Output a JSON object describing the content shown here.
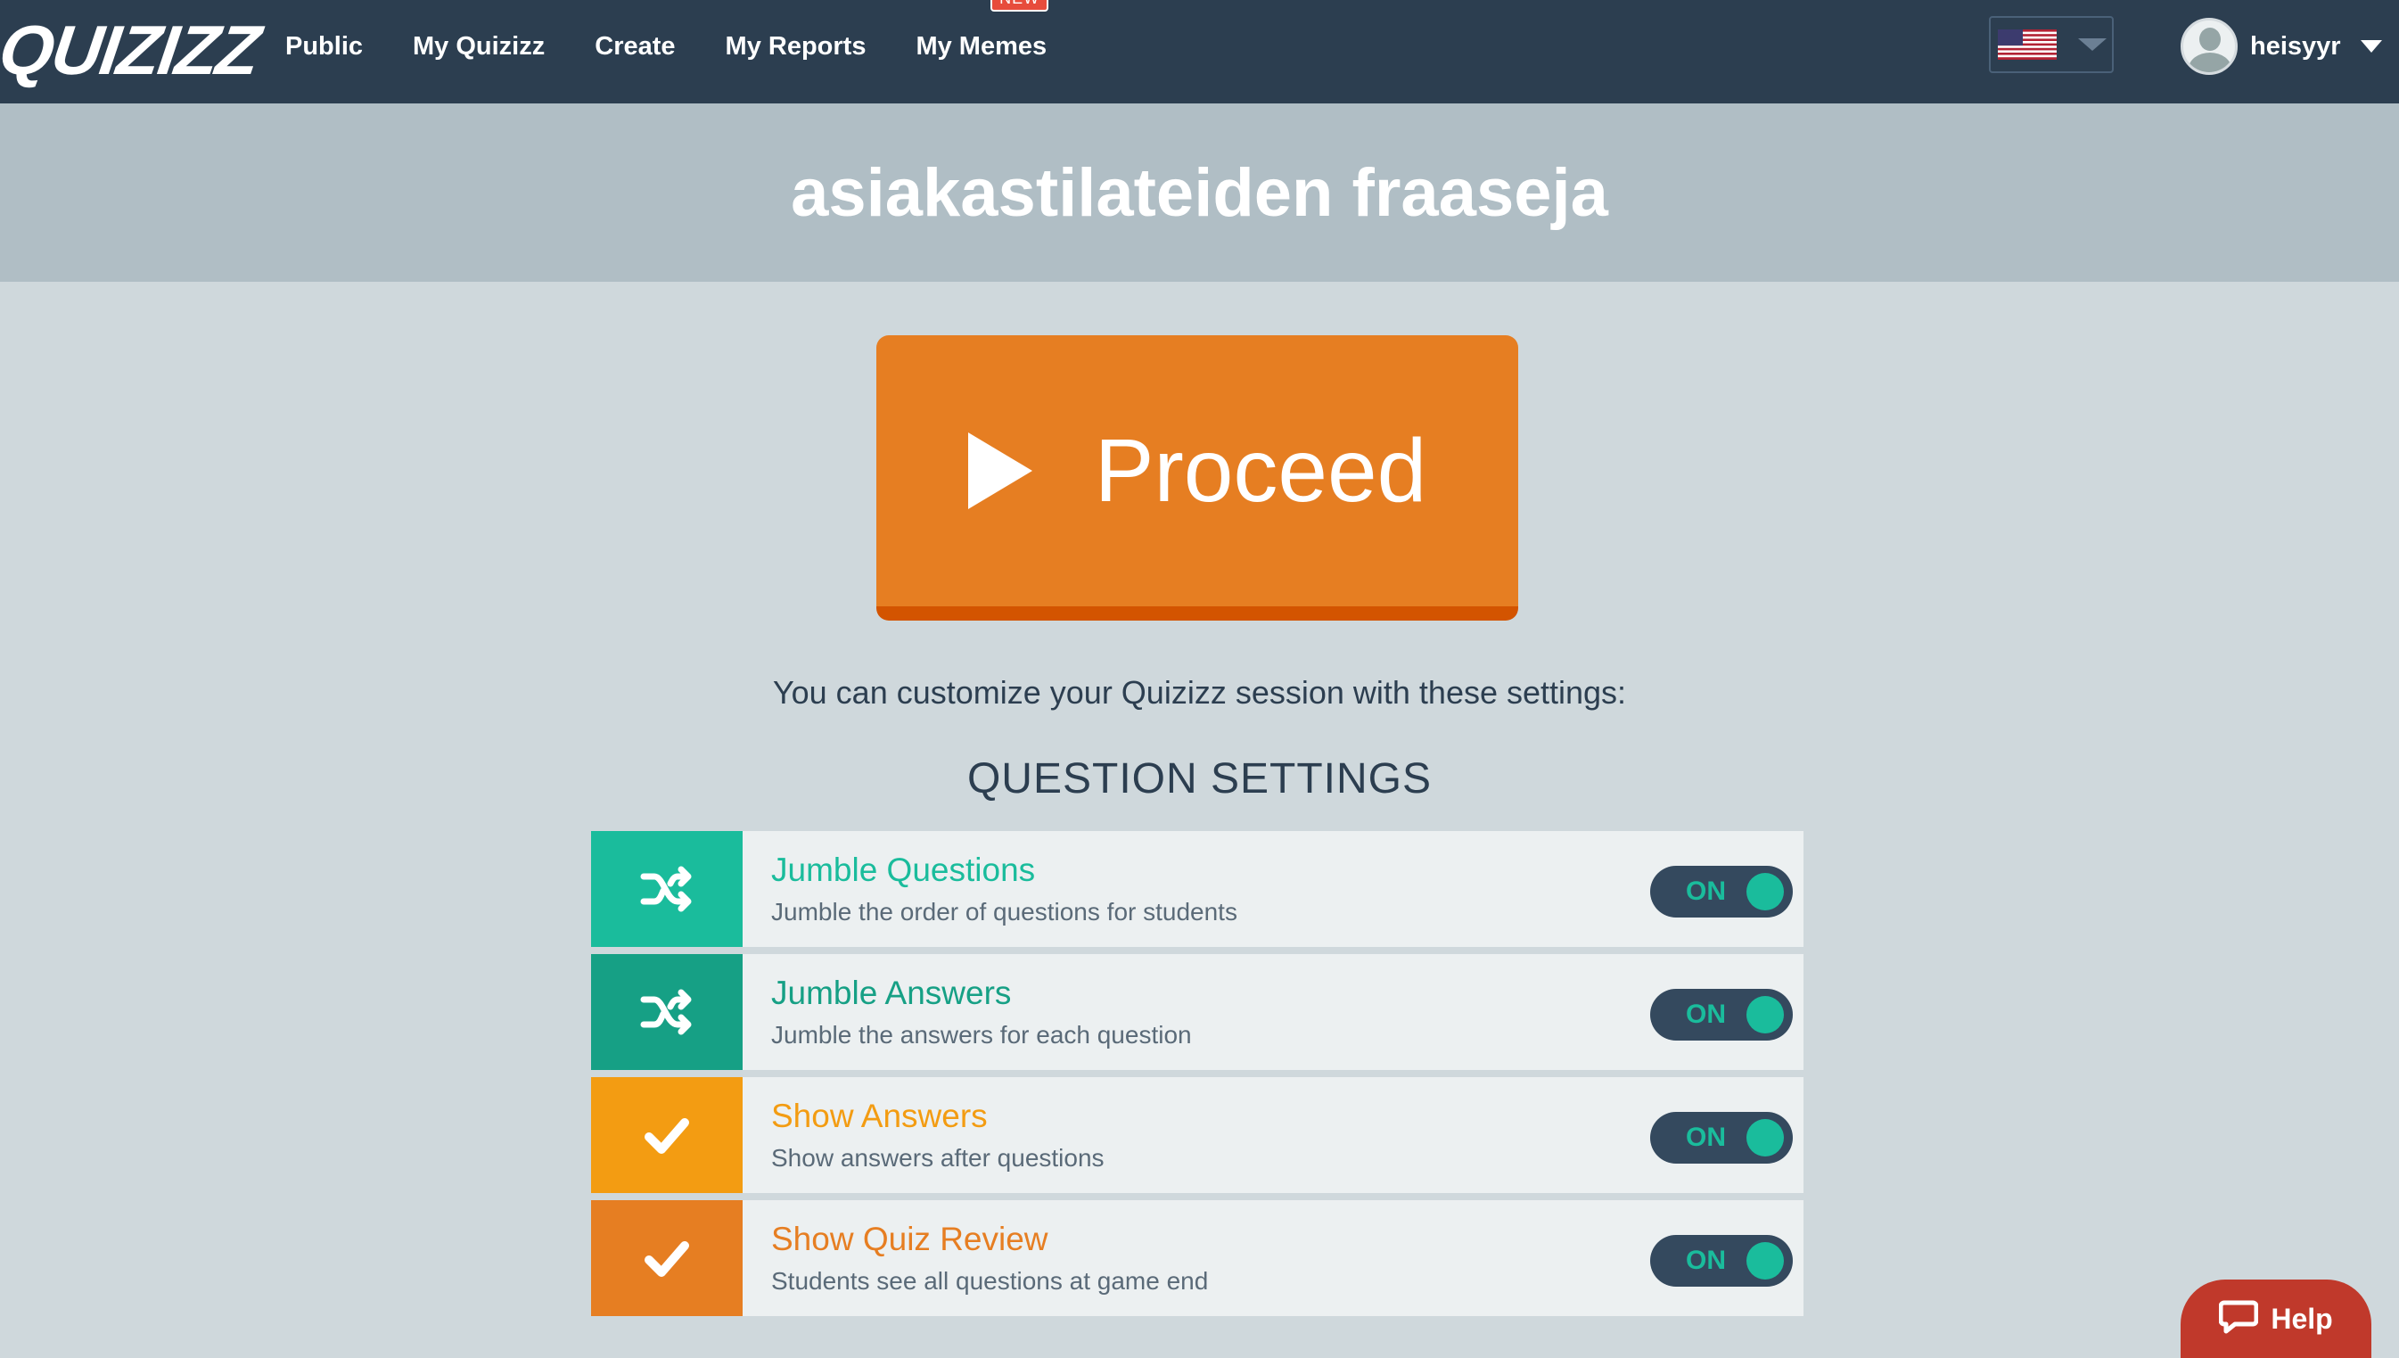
{
  "header": {
    "logo": "QUIZIZZ",
    "nav": [
      {
        "label": "Public"
      },
      {
        "label": "My Quizizz"
      },
      {
        "label": "Create"
      },
      {
        "label": "My Reports"
      },
      {
        "label": "My Memes",
        "badge": "NEW"
      }
    ],
    "language_flag": "us-flag-icon",
    "username": "heisyyr"
  },
  "quiz": {
    "title": "asiakastilateiden fraaseja"
  },
  "proceed": {
    "label": "Proceed"
  },
  "subtitle": "You can customize your Quizizz session with these settings:",
  "section_title": "QUESTION SETTINGS",
  "settings": [
    {
      "title": "Jumble Questions",
      "description": "Jumble the order of questions for students",
      "icon": "shuffle-icon",
      "color": "#1abc9c",
      "toggle": "ON"
    },
    {
      "title": "Jumble Answers",
      "description": "Jumble the answers for each question",
      "icon": "shuffle-icon",
      "color": "#16a085",
      "toggle": "ON"
    },
    {
      "title": "Show Answers",
      "description": "Show answers after questions",
      "icon": "check-icon",
      "color": "#f39c12",
      "toggle": "ON"
    },
    {
      "title": "Show Quiz Review",
      "description": "Students see all questions at game end",
      "icon": "check-icon",
      "color": "#e67e22",
      "toggle": "ON"
    }
  ],
  "help": {
    "label": "Help"
  },
  "colors": {
    "navbar": "#2c3e50",
    "title_band": "#b0bec5",
    "background": "#cfd8dc",
    "proceed": "#e67e22",
    "toggle_on": "#1abc9c"
  }
}
